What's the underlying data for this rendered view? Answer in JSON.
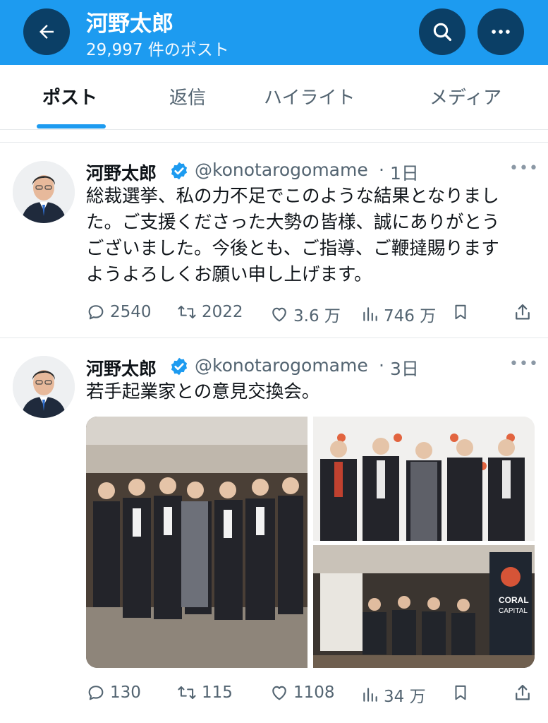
{
  "header": {
    "title": "河野太郎",
    "subtitle": "29,997 件のポスト"
  },
  "tabs": [
    {
      "label": "ポスト",
      "active": true
    },
    {
      "label": "返信",
      "active": false
    },
    {
      "label": "ハイライト",
      "active": false
    },
    {
      "label": "メディア",
      "active": false
    }
  ],
  "tweets": [
    {
      "name": "河野太郎",
      "handle": "@konotarogomame",
      "time": "1日",
      "lines": [
        "総裁選挙、私の力不足でこのような結果となりまし",
        "た。ご支援くださった大勢の皆様、誠にありがとう",
        "ございました。今後とも、ご指導、ご鞭撻賜ります",
        "ようよろしくお願い申し上げます。"
      ],
      "replies": "2540",
      "reposts": "2022",
      "likes": "3.6 万",
      "views": "746 万"
    },
    {
      "name": "河野太郎",
      "handle": "@konotarogomame",
      "time": "3日",
      "lines": [
        "若手起業家との意見交換会。"
      ],
      "replies": "130",
      "reposts": "115",
      "likes": "1108",
      "views": "34 万"
    }
  ],
  "media": {
    "backdrop_logo_text": "CORAL",
    "backdrop_logo_sub": "CAPITAL"
  },
  "colors": {
    "accent": "#1d9bf0",
    "header_button": "#0b3f66",
    "verified": "#1d9bf0",
    "muted_text": "#536471"
  },
  "icons": {
    "back": "arrow-left-icon",
    "search": "search-icon",
    "more": "more-horizontal-icon",
    "verified": "verified-badge-icon",
    "reply": "reply-icon",
    "repost": "repost-icon",
    "like": "heart-icon",
    "views": "views-icon",
    "bookmark": "bookmark-icon",
    "share": "share-icon"
  }
}
